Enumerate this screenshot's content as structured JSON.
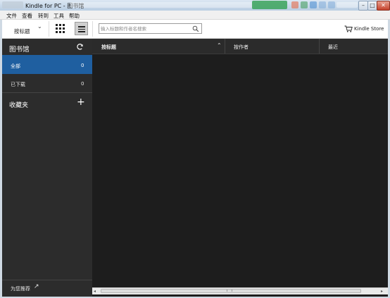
{
  "window": {
    "title": "Kindle for PC - 图书馆",
    "controls": {
      "minimize": "–",
      "maximize": "□",
      "close": "✕"
    }
  },
  "menu": {
    "items": [
      "文件",
      "查看",
      "转到",
      "工具",
      "帮助"
    ]
  },
  "toolbar": {
    "sort_label": "按标题",
    "sort_chevron": "⌄",
    "view_mode": "list",
    "search": {
      "value": "",
      "placeholder": "输入标题和作者名搜索"
    },
    "store_label": "Kindle Store"
  },
  "sidebar": {
    "title": "图书馆",
    "items": [
      {
        "label": "全部",
        "count": "0",
        "selected": true
      },
      {
        "label": "已下载",
        "count": "0",
        "selected": false
      }
    ],
    "collections_label": "收藏夹",
    "add_icon": "+",
    "recommend_label": "为您推荐",
    "recommend_icon": "↗"
  },
  "list": {
    "columns": [
      {
        "label": "按标题",
        "sorted": "asc"
      },
      {
        "label": "按作者"
      },
      {
        "label": "最近"
      }
    ],
    "sort_icon": "⌃",
    "rows": []
  },
  "scrollbar": {
    "left_arrow": "◂",
    "right_arrow": "▸"
  },
  "colors": {
    "sidebar_bg": "#2c2c2c",
    "selected_bg": "#1f5fa0",
    "list_bg": "#1d1d1d",
    "header_bg": "#2b2b2b"
  }
}
